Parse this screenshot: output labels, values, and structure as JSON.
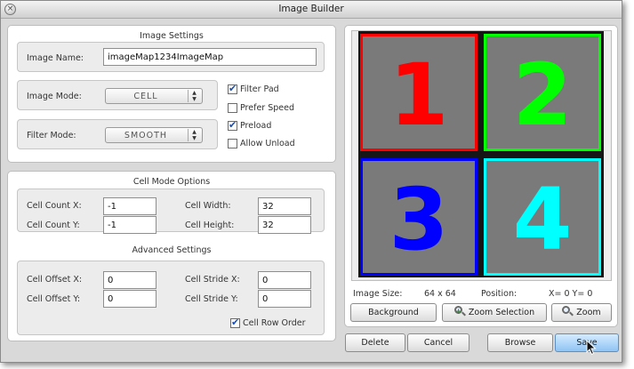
{
  "window": {
    "title": "Image Builder"
  },
  "image_settings": {
    "title": "Image Settings",
    "name_label": "Image Name:",
    "name_value": "imageMap1234ImageMap",
    "mode_label": "Image Mode:",
    "mode_value": "CELL",
    "filter_label": "Filter Mode:",
    "filter_value": "SMOOTH",
    "checkboxes": [
      {
        "label": "Filter Pad",
        "checked": true
      },
      {
        "label": "Prefer Speed",
        "checked": false
      },
      {
        "label": "Preload",
        "checked": true
      },
      {
        "label": "Allow Unload",
        "checked": false
      }
    ]
  },
  "cell_mode": {
    "title": "Cell Mode Options",
    "count_x_label": "Cell Count X:",
    "count_x": "-1",
    "count_y_label": "Cell Count Y:",
    "count_y": "-1",
    "width_label": "Cell Width:",
    "width": "32",
    "height_label": "Cell Height:",
    "height": "32"
  },
  "advanced": {
    "title": "Advanced Settings",
    "offset_x_label": "Cell Offset X:",
    "offset_x": "0",
    "offset_y_label": "Cell Offset Y:",
    "offset_y": "0",
    "stride_x_label": "Cell Stride X:",
    "stride_x": "0",
    "stride_y_label": "Cell Stride Y:",
    "stride_y": "0",
    "row_order_label": "Cell Row Order",
    "row_order_checked": true
  },
  "preview": {
    "tiles": [
      {
        "text": "1",
        "color": "#ff0000"
      },
      {
        "text": "2",
        "color": "#00ff00"
      },
      {
        "text": "3",
        "color": "#0000ff"
      },
      {
        "text": "4",
        "color": "#00ffff"
      }
    ],
    "size_label": "Image Size:",
    "size_value": "64 x 64",
    "position_label": "Position:",
    "position_value": "X= 0  Y= 0",
    "background_button": "Background",
    "zoom_selection_button": "Zoom Selection",
    "zoom_button": "Zoom"
  },
  "footer": {
    "delete": "Delete",
    "cancel": "Cancel",
    "browse": "Browse",
    "save": "Save"
  }
}
